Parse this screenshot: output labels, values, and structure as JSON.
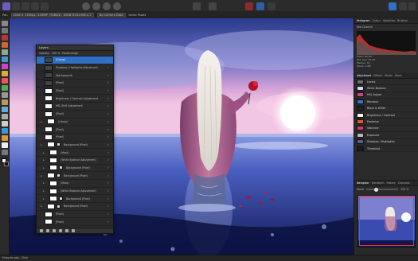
{
  "toolbar": {
    "ctx_items": [
      "Pan",
      "2048 × 1365px, 3.68MP, RGBA/8 - sRGB IEC61966-2.1",
      "No Camera Data",
      "Units: Pixels"
    ]
  },
  "layers_panel": {
    "title": "Layers",
    "opacity_label": "Opacity:",
    "opacity_value": "100 %",
    "blend_mode": "Passthrough",
    "rows": [
      {
        "name": "(Group)",
        "selected": true,
        "dark": true,
        "indent": 0,
        "fx": false
      },
      {
        "name": "Shadows / Highlights Adjustment",
        "selected": false,
        "dark": true,
        "indent": 0,
        "fx": false
      },
      {
        "name": "(Background)",
        "selected": false,
        "dark": true,
        "indent": 0,
        "fx": false
      },
      {
        "name": "(Pixel)",
        "selected": false,
        "dark": true,
        "indent": 0,
        "fx": false
      },
      {
        "name": "(Pixel)",
        "selected": false,
        "dark": false,
        "indent": 0,
        "fx": false
      },
      {
        "name": "Brightness / Contrast Adjustment",
        "selected": false,
        "dark": false,
        "indent": 0,
        "fx": false
      },
      {
        "name": "HSL Shift Adjustment",
        "selected": false,
        "dark": false,
        "indent": 0,
        "fx": false
      },
      {
        "name": "(Pixel)",
        "selected": false,
        "dark": false,
        "indent": 0,
        "fx": false
      },
      {
        "name": "(Group)",
        "selected": false,
        "dark": false,
        "indent": 1,
        "fx": false
      },
      {
        "name": "(Pixel)",
        "selected": false,
        "dark": false,
        "indent": 0,
        "fx": false
      },
      {
        "name": "(Pixel)",
        "selected": false,
        "dark": false,
        "indent": 0,
        "fx": false
      },
      {
        "name": "Background (Pixel)",
        "selected": false,
        "dark": false,
        "indent": 1,
        "fx": true
      },
      {
        "name": "(Mask)",
        "selected": false,
        "dark": false,
        "indent": 2,
        "fx": false
      },
      {
        "name": "(White Balance Adjustment)",
        "selected": false,
        "dark": false,
        "indent": 2,
        "fx": false
      },
      {
        "name": "Background (Pixel)",
        "selected": false,
        "dark": false,
        "indent": 2,
        "fx": true
      },
      {
        "name": "Background (Pixel)",
        "selected": false,
        "dark": false,
        "indent": 1,
        "fx": true
      },
      {
        "name": "(Mask)",
        "selected": false,
        "dark": false,
        "indent": 2,
        "fx": false
      },
      {
        "name": "(White Balance Adjustment)",
        "selected": false,
        "dark": false,
        "indent": 2,
        "fx": false
      },
      {
        "name": "Background (Pixel)",
        "selected": false,
        "dark": false,
        "indent": 2,
        "fx": true
      },
      {
        "name": "Background (Pixel)",
        "selected": false,
        "dark": false,
        "indent": 1,
        "fx": true
      },
      {
        "name": "(Pixel)",
        "selected": false,
        "dark": false,
        "indent": 0,
        "fx": false
      },
      {
        "name": "(Pixel)",
        "selected": false,
        "dark": false,
        "indent": 0,
        "fx": false
      }
    ]
  },
  "studio": {
    "top_tabs": [
      "Histogram",
      "Colour",
      "Swatches",
      "Brushes"
    ],
    "histogram_channel": "Red Channel",
    "histogram_stats": [
      "Mean: 82.00",
      "Std. Dev: 67.08",
      "Median: 53",
      "Pixels: 2.8M"
    ],
    "mid_tabs": [
      "Adjustment",
      "Effects",
      "Styles",
      "Stock"
    ],
    "adjustments": [
      {
        "name": "Levels",
        "color": "#6e6e6e"
      },
      {
        "name": "White Balance",
        "color": "#cfd8e6"
      },
      {
        "name": "HSL Adjust",
        "color": "#c24a7a"
      },
      {
        "name": "Recolour",
        "color": "#3d6fd0"
      },
      {
        "name": "Black & White",
        "color": "#222222"
      },
      {
        "name": "Brightness / Contrast",
        "color": "#f2f2f2"
      },
      {
        "name": "Posterise",
        "color": "#d65a2b"
      },
      {
        "name": "Vibrance",
        "color": "#d13b6b"
      },
      {
        "name": "Exposure",
        "color": "#b8b8b8"
      },
      {
        "name": "Shadows / Highlights",
        "color": "#5b5b8a"
      },
      {
        "name": "Threshold",
        "color": "#1a1a1a"
      }
    ],
    "nav_tabs": [
      "Navigator",
      "Transform",
      "History",
      "Channels"
    ],
    "zoom_label": "Zoom",
    "zoom_value": "100 %"
  },
  "status": {
    "text": "Drag to pan. Click"
  },
  "colors": {
    "selection": "#2f6fc4",
    "check": "#8fd18f"
  }
}
